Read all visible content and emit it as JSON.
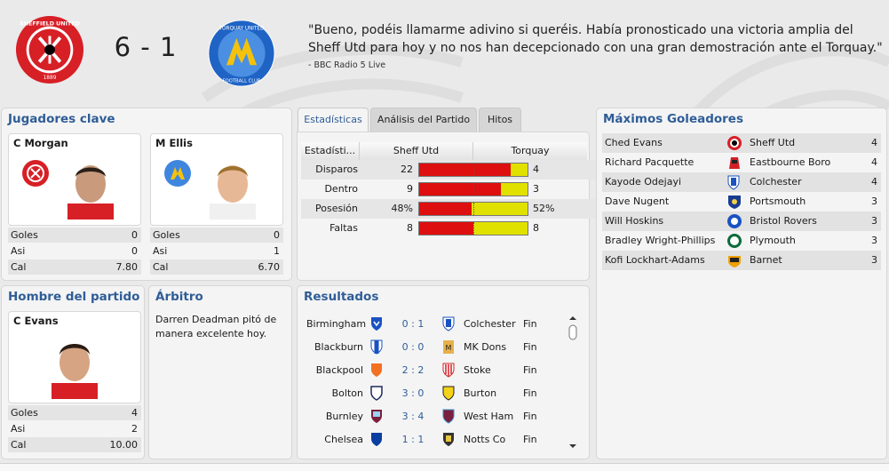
{
  "header": {
    "score": "6 - 1",
    "home_crest_text": "SHEFFIELD UNITED F.C.",
    "home_crest_year": "1889",
    "away_crest_text": "TORQUAY UNITED FOOTBALL CLUB",
    "quote": "\"Bueno, podéis llamarme adivino si queréis. Había pronosticado una victoria amplia del Sheff Utd para hoy y no nos han decepcionado con una gran demostración ante el Torquay.\"",
    "quote_source": "- BBC Radio 5 Live"
  },
  "key_players": {
    "title": "Jugadores clave",
    "players": [
      {
        "name": "C Morgan",
        "stats": [
          {
            "label": "Goles",
            "value": "0"
          },
          {
            "label": "Asi",
            "value": "0"
          },
          {
            "label": "Cal",
            "value": "7.80"
          }
        ]
      },
      {
        "name": "M Ellis",
        "stats": [
          {
            "label": "Goles",
            "value": "0"
          },
          {
            "label": "Asi",
            "value": "1"
          },
          {
            "label": "Cal",
            "value": "6.70"
          }
        ]
      }
    ]
  },
  "mom": {
    "title": "Hombre del partido",
    "name": "C Evans",
    "stats": [
      {
        "label": "Goles",
        "value": "4"
      },
      {
        "label": "Asi",
        "value": "2"
      },
      {
        "label": "Cal",
        "value": "10.00"
      }
    ]
  },
  "referee": {
    "title": "Árbitro",
    "text": "Darren Deadman pitó de manera excelente hoy."
  },
  "tabs": [
    {
      "label": "Estadísticas",
      "active": true
    },
    {
      "label": "Análisis del Partido",
      "active": false
    },
    {
      "label": "Hitos",
      "active": false
    }
  ],
  "stats": {
    "col_label": "Estadísti...",
    "col_home": "Sheff Utd",
    "col_away": "Torquay",
    "rows": [
      {
        "label": "Disparos",
        "home": "22",
        "away": "4",
        "home_fraction": 0.846
      },
      {
        "label": "Dentro",
        "home": "9",
        "away": "3",
        "home_fraction": 0.75
      },
      {
        "label": "Posesión",
        "home": "48%",
        "away": "52%",
        "home_fraction": 0.48
      },
      {
        "label": "Faltas",
        "home": "8",
        "away": "8",
        "home_fraction": 0.5
      }
    ]
  },
  "results": {
    "title": "Resultados",
    "rows": [
      {
        "home": "Birmingham",
        "score": "0 : 1",
        "away": "Colchester",
        "status": "Fin"
      },
      {
        "home": "Blackburn",
        "score": "0 : 0",
        "away": "MK Dons",
        "status": "Fin"
      },
      {
        "home": "Blackpool",
        "score": "2 : 2",
        "away": "Stoke",
        "status": "Fin"
      },
      {
        "home": "Bolton",
        "score": "3 : 0",
        "away": "Burton",
        "status": "Fin"
      },
      {
        "home": "Burnley",
        "score": "3 : 4",
        "away": "West Ham",
        "status": "Fin"
      },
      {
        "home": "Chelsea",
        "score": "1 : 1",
        "away": "Notts Co",
        "status": "Fin"
      }
    ]
  },
  "scorers": {
    "title": "Máximos Goleadores",
    "rows": [
      {
        "name": "Ched Evans",
        "club": "Sheff Utd",
        "goals": "4"
      },
      {
        "name": "Richard Pacquette",
        "club": "Eastbourne Boro",
        "goals": "4"
      },
      {
        "name": "Kayode Odejayi",
        "club": "Colchester",
        "goals": "4"
      },
      {
        "name": "Dave Nugent",
        "club": "Portsmouth",
        "goals": "3"
      },
      {
        "name": "Will Hoskins",
        "club": "Bristol Rovers",
        "goals": "3"
      },
      {
        "name": "Bradley Wright-Phillips",
        "club": "Plymouth",
        "goals": "3"
      },
      {
        "name": "Kofi Lockhart-Adams",
        "club": "Barnet",
        "goals": "3"
      }
    ]
  },
  "colors": {
    "accent": "#2f5d97",
    "home_bar": "#dd0f0f",
    "away_bar": "#e1e100"
  }
}
